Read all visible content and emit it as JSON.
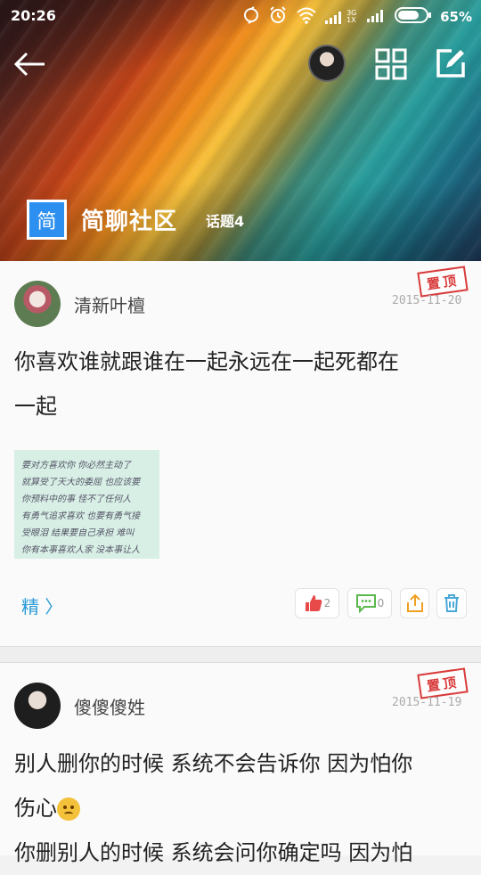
{
  "status_bar": {
    "time": "20:26",
    "network": "3G 1X",
    "battery": "65%"
  },
  "header": {
    "community_logo_char": "简",
    "community_name": "简聊社区",
    "topics_label": "话题4"
  },
  "posts": [
    {
      "username": "清新叶檀",
      "pinned_label": "置顶",
      "date": "2015-11-20",
      "text_line1": "你喜欢谁就跟谁在一起永远在一起死都在",
      "text_line2": "一起",
      "image_lines": [
        "要对方喜欢你  你必然主动了",
        "就算受了天大的委屈  也应该要",
        "你预料中的事  怪不了任何人",
        "有勇气追求喜欢  也要有勇气接",
        "受眼泪  结果要自己承担  难叫",
        "你有本事喜欢人家  没本事让人"
      ],
      "featured_label": "精 〉",
      "likes": "2",
      "comments": "0"
    },
    {
      "username": "傻傻傻姓",
      "pinned_label": "置顶",
      "date": "2015-11-19",
      "text_line1": "别人删你的时候 系统不会告诉你 因为怕你",
      "text_line2": "伤心",
      "text_line3": "你删别人的时候 系统会问你确定吗 因为怕"
    }
  ],
  "colors": {
    "accent": "#2a9bd8",
    "pinned": "#d93b3b",
    "like": "#e84a4a",
    "comment": "#59b84b",
    "share": "#f0a020",
    "delete": "#4aa8d8"
  }
}
